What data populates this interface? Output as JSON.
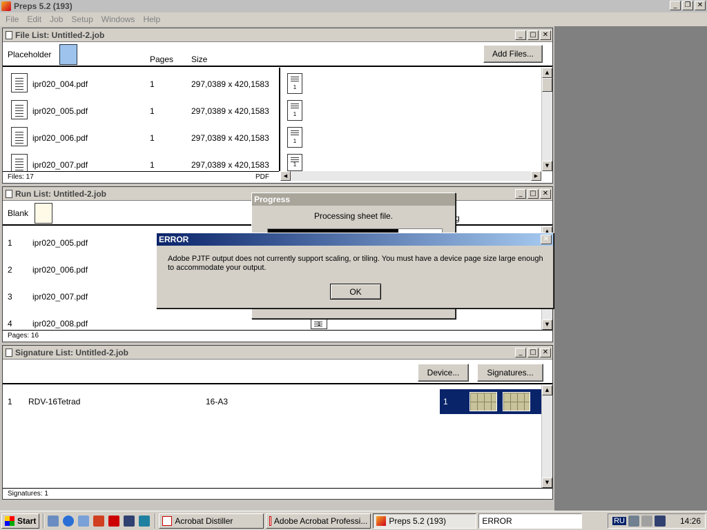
{
  "app": {
    "title": "Preps 5.2 (193)"
  },
  "menu": [
    "File",
    "Edit",
    "Job",
    "Setup",
    "Windows",
    "Help"
  ],
  "file_list": {
    "title": "File List:  Untitled-2.job",
    "placeholder_label": "Placeholder",
    "col_pages": "Pages",
    "col_size": "Size",
    "add_files": "Add Files...",
    "rows": [
      {
        "name": "ipr020_004.pdf",
        "pages": "1",
        "size": "297,0389 x 420,1583"
      },
      {
        "name": "ipr020_005.pdf",
        "pages": "1",
        "size": "297,0389 x 420,1583"
      },
      {
        "name": "ipr020_006.pdf",
        "pages": "1",
        "size": "297,0389 x 420,1583"
      },
      {
        "name": "ipr020_007.pdf",
        "pages": "1",
        "size": "297,0389 x 420,1583"
      }
    ],
    "thumb_label": "1",
    "status_files": "Files: 17",
    "status_type": "PDF"
  },
  "run_list": {
    "title": "Run List:  Untitled-2.job",
    "blank_label": "Blank",
    "rows": [
      {
        "num": "1",
        "name": "ipr020_005.pdf"
      },
      {
        "num": "2",
        "name": "ipr020_006.pdf"
      },
      {
        "num": "3",
        "name": "ipr020_007.pdf"
      },
      {
        "num": "4",
        "name": "ipr020_008.pdf"
      }
    ],
    "partial_col": "g",
    "thumb_label": "1",
    "status": "Pages: 16"
  },
  "signature_list": {
    "title": "Signature List:  Untitled-2.job",
    "device_btn": "Device...",
    "signatures_btn": "Signatures...",
    "row": {
      "num": "1",
      "name": "RDV-16Tetrad",
      "size": "16-A3",
      "sig_num": "1"
    },
    "status": "Signatures: 1"
  },
  "progress": {
    "title": "Progress",
    "message": "Processing  sheet file.",
    "fraction": 0.75
  },
  "error": {
    "title": "ERROR",
    "message": "Adobe PJTF output does not currently support scaling, or tiling. You must have a device page size large enough to accommodate your output.",
    "ok": "OK"
  },
  "taskbar": {
    "start": "Start",
    "tasks": [
      "Acrobat Distiller",
      "Adobe Acrobat Professi...",
      "Preps 5.2 (193)"
    ],
    "status_text": "ERROR",
    "lang": "RU",
    "clock": "14:26"
  },
  "colors": {
    "selection": "#0a246a",
    "title_gradient_start": "#0a246a",
    "title_gradient_end": "#a6caf0"
  }
}
